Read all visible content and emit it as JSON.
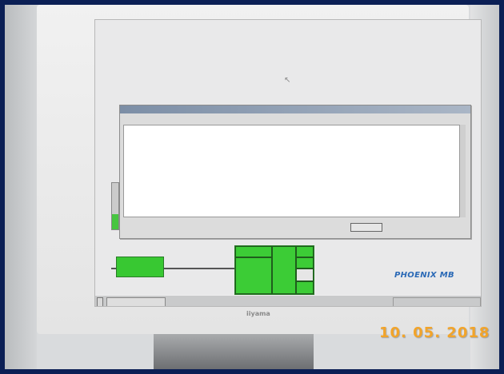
{
  "screen": {
    "title_strip": "",
    "cursor_glyph": "↖"
  },
  "dialog": {
    "title": "",
    "close_button_label": "",
    "log_rows": [
      [
        "",
        "",
        "",
        ""
      ],
      [
        "",
        "",
        "",
        ""
      ],
      [
        "",
        "",
        "",
        ""
      ],
      [
        "",
        "",
        "",
        ""
      ],
      [
        "",
        "",
        "",
        ""
      ],
      [
        "",
        "",
        "",
        ""
      ],
      [
        "",
        "",
        "",
        ""
      ],
      [
        "",
        "",
        "",
        ""
      ],
      [
        "",
        "",
        "",
        ""
      ],
      [
        "",
        "",
        "",
        ""
      ],
      [
        "",
        "",
        "",
        ""
      ],
      [
        "",
        "",
        "",
        ""
      ],
      [
        "",
        "",
        "",
        ""
      ],
      [
        "",
        "",
        "",
        ""
      ]
    ]
  },
  "process": {
    "level_fraction": 0.32,
    "accent": "#3ccc36"
  },
  "logo": {
    "text": "PHOENIX MB",
    "color": "#2a69b6"
  },
  "taskbar": {
    "start_label": "",
    "task_label": "",
    "tray_text": ""
  },
  "monitor": {
    "brand": "iiyama"
  },
  "photo": {
    "date_stamp": "10. 05. 2018",
    "date_color": "#f2a42a"
  }
}
